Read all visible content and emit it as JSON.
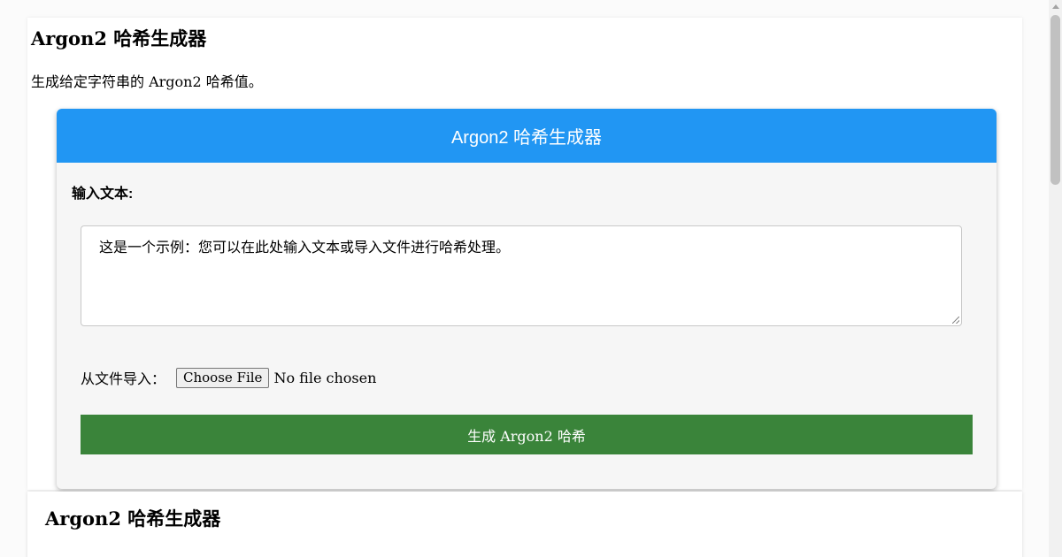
{
  "page": {
    "title": "Argon2 哈希生成器",
    "description": "生成给定字符串的 Argon2 哈希值。"
  },
  "tool": {
    "header": "Argon2 哈希生成器",
    "input_label": "输入文本:",
    "input_value": "这是一个示例：您可以在此处输入文本或导入文件进行哈希处理。",
    "file_label": "从文件导入：",
    "file_button": "Choose File",
    "file_status": "No file chosen",
    "generate_button": "生成 Argon2 哈希"
  },
  "article": {
    "title": "Argon2 哈希生成器"
  },
  "colors": {
    "header_bg": "#2196f3",
    "button_bg": "#3a843a",
    "card_bg": "#f6f6f6"
  }
}
